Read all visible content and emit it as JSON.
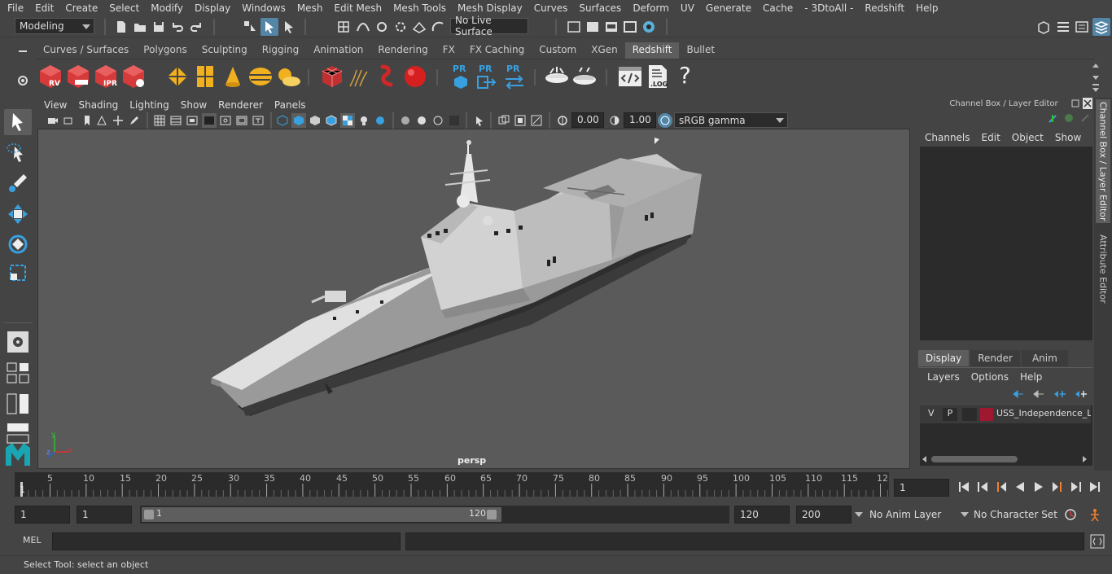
{
  "menubar": {
    "items": [
      "File",
      "Edit",
      "Create",
      "Select",
      "Modify",
      "Display",
      "Windows",
      "Mesh",
      "Edit Mesh",
      "Mesh Tools",
      "Mesh Display",
      "Curves",
      "Surfaces",
      "Deform",
      "UV",
      "Generate",
      "Cache",
      "- 3DtoAll -",
      "Redshift",
      "Help"
    ]
  },
  "statusline": {
    "mode": "Modeling",
    "live_surface": "No Live Surface"
  },
  "shelf": {
    "tabs": [
      "Curves / Surfaces",
      "Polygons",
      "Sculpting",
      "Rigging",
      "Animation",
      "Rendering",
      "FX",
      "FX Caching",
      "Custom",
      "XGen",
      "Redshift",
      "Bullet"
    ],
    "active_tab": "Redshift",
    "icon_labels": {
      "rv": "RV",
      "ipr": "IPR",
      "pr": "PR",
      "log": ".LOG",
      "help": "?",
      "code": "</>"
    }
  },
  "viewport": {
    "menus": [
      "View",
      "Shading",
      "Lighting",
      "Show",
      "Renderer",
      "Panels"
    ],
    "exposure": "0.00",
    "gamma": "1.00",
    "color_space": "sRGB gamma",
    "camera_label": "persp",
    "axis": {
      "x": "x",
      "y": "y",
      "z": "z"
    }
  },
  "channel_box": {
    "title": "Channel Box / Layer Editor",
    "menus": [
      "Channels",
      "Edit",
      "Object",
      "Show"
    ],
    "layer_tabs": [
      "Display",
      "Render",
      "Anim"
    ],
    "active_layer_tab": "Display",
    "layer_menus": [
      "Layers",
      "Options",
      "Help"
    ],
    "layer": {
      "v": "V",
      "p": "P",
      "name": "USS_Independence_LC",
      "color": "#a01830"
    }
  },
  "side_tabs": [
    "Channel Box / Layer Editor",
    "Attribute Editor"
  ],
  "timeline": {
    "ticks": [
      "5",
      "10",
      "15",
      "20",
      "25",
      "30",
      "35",
      "40",
      "45",
      "50",
      "55",
      "60",
      "65",
      "70",
      "75",
      "80",
      "85",
      "90",
      "95",
      "100",
      "105",
      "110",
      "115",
      "12"
    ],
    "start_marker": "1",
    "current_frame": "1"
  },
  "range": {
    "start": "1",
    "playback_start": "1",
    "slider_start": "1",
    "slider_end": "120",
    "playback_end": "120",
    "end": "200",
    "anim_layer": "No Anim Layer",
    "character_set": "No Character Set"
  },
  "cmdline": {
    "label": "MEL"
  },
  "helpline": {
    "text": "Select Tool: select an object"
  },
  "colors": {
    "accent": "#5285a6",
    "active_tab": "#5d5d5d",
    "background": "#444444",
    "field": "#2b2b2b",
    "viewport": "#5a5a5a"
  }
}
